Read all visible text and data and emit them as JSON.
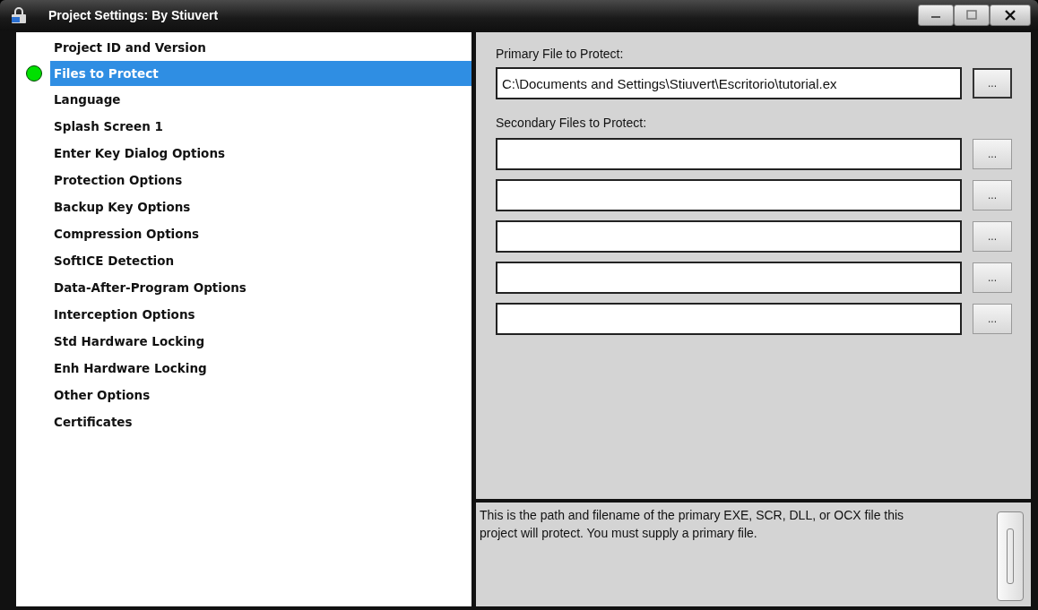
{
  "window": {
    "title": "Project Settings: By Stiuvert"
  },
  "sidebar": {
    "items": [
      {
        "label": "Project ID and Version",
        "selected": false
      },
      {
        "label": "Files to Protect",
        "selected": true
      },
      {
        "label": "Language",
        "selected": false
      },
      {
        "label": "Splash Screen 1",
        "selected": false
      },
      {
        "label": "Enter Key Dialog Options",
        "selected": false
      },
      {
        "label": "Protection Options",
        "selected": false
      },
      {
        "label": "Backup Key Options",
        "selected": false
      },
      {
        "label": "Compression Options",
        "selected": false
      },
      {
        "label": "SoftICE Detection",
        "selected": false
      },
      {
        "label": "Data-After-Program Options",
        "selected": false
      },
      {
        "label": "Interception Options",
        "selected": false
      },
      {
        "label": "Std Hardware Locking",
        "selected": false
      },
      {
        "label": "Enh Hardware Locking",
        "selected": false
      },
      {
        "label": "Other Options",
        "selected": false
      },
      {
        "label": "Certificates",
        "selected": false
      }
    ]
  },
  "primary": {
    "label": "Primary File to Protect:",
    "value": "C:\\Documents and Settings\\Stiuvert\\Escritorio\\tutorial.ex",
    "button": "..."
  },
  "secondary": {
    "label": "Secondary Files to Protect:",
    "fields": [
      {
        "button": "..."
      },
      {
        "button": "..."
      },
      {
        "button": "..."
      },
      {
        "button": "..."
      },
      {
        "button": "..."
      }
    ]
  },
  "description": "This is the path and filename of the primary EXE, SCR, DLL, or OCX file this project will protect. You must supply a primary file."
}
